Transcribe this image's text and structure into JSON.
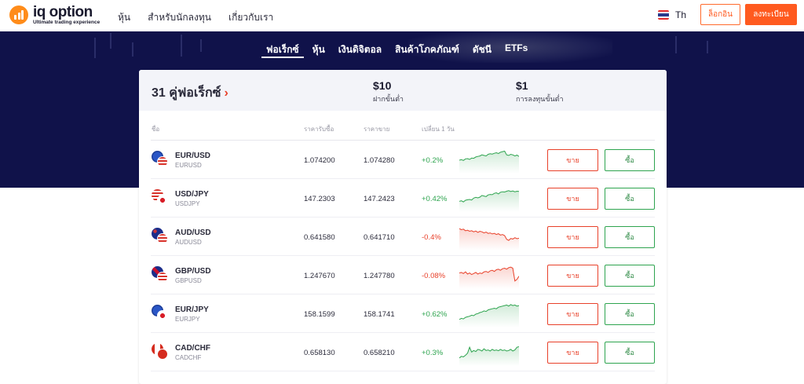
{
  "brand": {
    "name": "iq option",
    "tagline": "Ultimate trading experience"
  },
  "nav": {
    "links": [
      "หุ้น",
      "สำหรับนักลงทุน",
      "เกี่ยวกับเรา"
    ]
  },
  "lang": {
    "label": "Th"
  },
  "auth": {
    "login": "ล็อกอิน",
    "register": "ลงทะเบียน"
  },
  "tabs": [
    {
      "label": "ฟอเร็กซ์",
      "active": true
    },
    {
      "label": "หุ้น",
      "active": false
    },
    {
      "label": "เงินดิจิตอล",
      "active": false
    },
    {
      "label": "สินค้าโภคภัณฑ์",
      "active": false
    },
    {
      "label": "ดัชนี",
      "active": false
    },
    {
      "label": "ETFs",
      "active": false
    }
  ],
  "summary": {
    "pairs_count": "31 คู่ฟอเร็กซ์",
    "min_deposit_value": "$10",
    "min_deposit_label": "ฝากขั้นต่ำ",
    "min_invest_value": "$1",
    "min_invest_label": "การลงทุนขั้นต่ำ"
  },
  "columns": {
    "name": "ชื่อ",
    "buy_price": "ราคารับซื้อ",
    "sell_price": "ราคาขาย",
    "change": "เปลี่ยน 1 วัน"
  },
  "actions": {
    "sell": "ขาย",
    "buy": "ซื้อ"
  },
  "rows": [
    {
      "pair": "EUR/USD",
      "code": "EURUSD",
      "bid": "1.074200",
      "ask": "1.074280",
      "change": "+0.2%",
      "trend": "up",
      "spark": [
        50,
        52,
        49,
        55,
        56,
        53,
        58,
        57,
        62,
        64,
        66,
        70,
        68,
        66,
        72,
        74,
        73,
        76,
        78,
        75,
        80,
        82,
        84,
        70,
        68,
        72,
        70,
        66,
        69,
        64
      ]
    },
    {
      "pair": "USD/JPY",
      "code": "USDJPY",
      "bid": "147.2303",
      "ask": "147.2423",
      "change": "+0.42%",
      "trend": "up",
      "spark": [
        40,
        42,
        38,
        44,
        46,
        47,
        45,
        52,
        55,
        53,
        56,
        62,
        60,
        58,
        64,
        66,
        65,
        70,
        72,
        68,
        74,
        76,
        75,
        78,
        80,
        77,
        79,
        76,
        78,
        77
      ]
    },
    {
      "pair": "AUD/USD",
      "code": "AUDUSD",
      "bid": "0.641580",
      "ask": "0.641710",
      "change": "-0.4%",
      "trend": "down",
      "spark": [
        82,
        78,
        80,
        74,
        76,
        72,
        74,
        70,
        73,
        68,
        72,
        70,
        66,
        69,
        64,
        66,
        62,
        64,
        60,
        63,
        58,
        60,
        56,
        42,
        38,
        45,
        43,
        48,
        44,
        46
      ]
    },
    {
      "pair": "GBP/USD",
      "code": "GBPUSD",
      "bid": "1.247670",
      "ask": "1.247780",
      "change": "-0.08%",
      "trend": "down",
      "spark": [
        60,
        62,
        58,
        64,
        56,
        60,
        54,
        58,
        62,
        56,
        60,
        58,
        64,
        66,
        62,
        68,
        70,
        66,
        72,
        74,
        70,
        76,
        78,
        74,
        80,
        82,
        78,
        30,
        36,
        48
      ]
    },
    {
      "pair": "EUR/JPY",
      "code": "EURJPY",
      "bid": "158.1599",
      "ask": "158.1741",
      "change": "+0.62%",
      "trend": "up",
      "spark": [
        30,
        34,
        32,
        38,
        40,
        42,
        46,
        44,
        50,
        52,
        56,
        58,
        62,
        60,
        66,
        68,
        70,
        72,
        70,
        76,
        78,
        80,
        82,
        84,
        80,
        86,
        82,
        84,
        80,
        82
      ]
    },
    {
      "pair": "CAD/CHF",
      "code": "CADCHF",
      "bid": "0.658130",
      "ask": "0.658210",
      "change": "+0.3%",
      "trend": "up",
      "spark": [
        30,
        36,
        34,
        40,
        48,
        70,
        52,
        58,
        54,
        62,
        60,
        56,
        64,
        58,
        60,
        56,
        62,
        58,
        60,
        57,
        62,
        58,
        60,
        56,
        58,
        62,
        56,
        60,
        70,
        72
      ]
    }
  ],
  "colors": {
    "accent": "#ff5a1f",
    "hero": "#10124a",
    "up": "#2ea44f",
    "down": "#e8412a"
  }
}
